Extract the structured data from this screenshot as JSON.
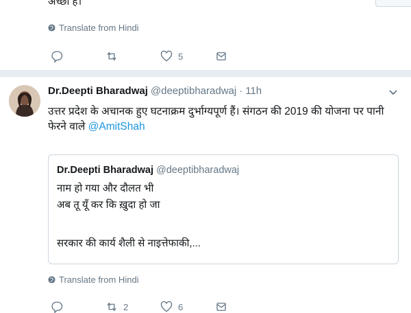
{
  "tweet_prev": {
    "cut_text": "अच्छा है।",
    "translate": "Translate from Hindi",
    "actions": {
      "reply_count": "",
      "retweet_count": "",
      "like_count": "5"
    }
  },
  "tweet": {
    "name": "Dr.Deepti Bharadwaj",
    "handle": "@deeptibharadwaj",
    "dot": "·",
    "time": "11h",
    "text_line1": "उत्तर प्रदेश के अचानक हुए घटनाक्रम दुर्भाग्यपूर्ण हैं।  संगठन की 2019 की योजना पर पानी",
    "text_line2_prefix": "फेरने वाले ",
    "mention": "@AmitShah",
    "quote": {
      "name": "Dr.Deepti Bharadwaj",
      "handle": "@deeptibharadwaj",
      "line1": "नाम हो गया और दौलत भी",
      "line2": "अब तू यूँ कर कि ख़ुदा हो जा",
      "line3": "सरकार की कार्य शैली से नाइत्तेफाकी,..."
    },
    "translate": "Translate from Hindi",
    "actions": {
      "retweet_count": "2",
      "like_count": "6"
    }
  },
  "colors": {
    "accent": "#1b95e0",
    "muted": "#657786",
    "divider": "#e6ecf0"
  }
}
